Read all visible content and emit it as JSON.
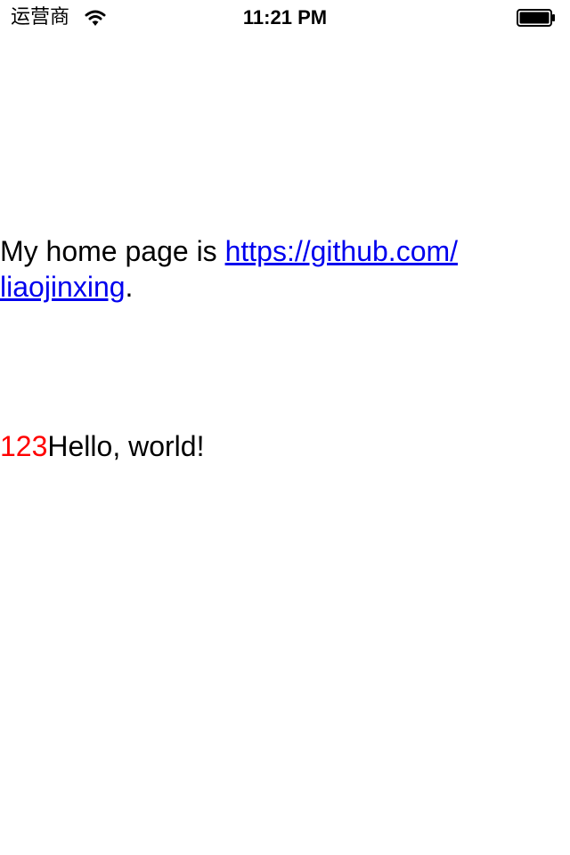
{
  "status_bar": {
    "carrier": "运营商",
    "time": "11:21 PM",
    "icons": [
      "wifi-icon",
      "battery-icon"
    ]
  },
  "content": {
    "home_page": {
      "prefix": "My home page is ",
      "link_line1": "https://github.com/",
      "link_line2": "liaojinxing",
      "suffix": "."
    },
    "hello": {
      "number": "123",
      "text": "Hello, world!"
    }
  },
  "colors": {
    "link": "#0000ee",
    "number": "#ff0000",
    "text": "#000000",
    "background": "#ffffff"
  }
}
